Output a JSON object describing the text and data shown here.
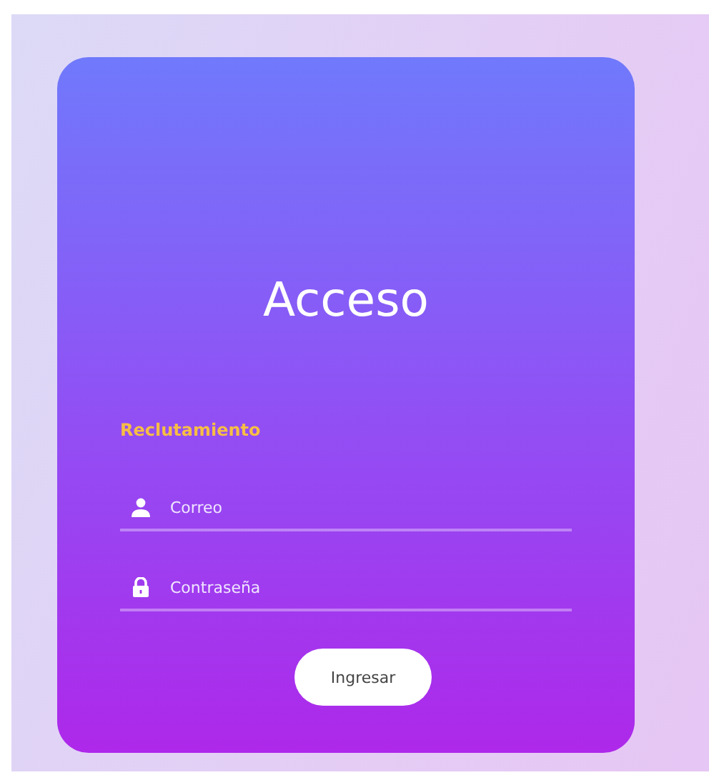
{
  "title": "Acceso",
  "subtitle": "Reclutamiento",
  "fields": [
    {
      "kind": "user",
      "placeholder": "Correo"
    },
    {
      "kind": "lock",
      "placeholder": "Contraseña"
    }
  ],
  "button": "Ingresar"
}
